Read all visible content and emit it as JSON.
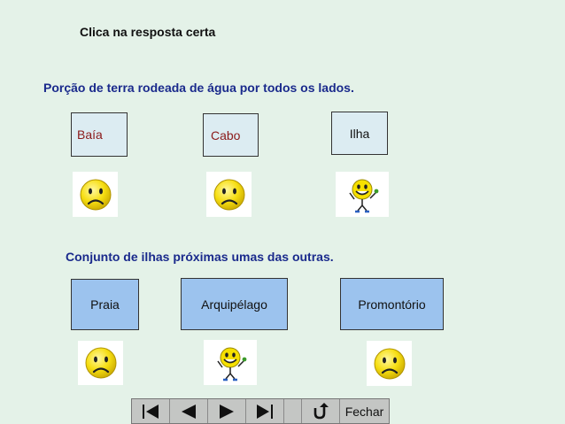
{
  "title": "Clica na resposta certa",
  "questions": [
    {
      "text": "Porção de terra rodeada de água por todos os lados.",
      "options": [
        {
          "label": "Baía",
          "text_color": "#8b1a1a",
          "feedback_icon": "sad-face-icon"
        },
        {
          "label": "Cabo",
          "text_color": "#8b1a1a",
          "feedback_icon": "sad-face-icon"
        },
        {
          "label": "Ilha",
          "text_color": "#111111",
          "feedback_icon": "happy-face-icon"
        }
      ]
    },
    {
      "text": "Conjunto de ilhas próximas umas das outras.",
      "options": [
        {
          "label": "Praia",
          "feedback_icon": "sad-face-icon"
        },
        {
          "label": "Arquipélago",
          "feedback_icon": "happy-face-icon"
        },
        {
          "label": "Promontório",
          "feedback_icon": "sad-face-icon"
        }
      ]
    }
  ],
  "nav": {
    "buttons": [
      "first-slide-icon",
      "previous-slide-icon",
      "next-slide-icon",
      "last-slide-icon",
      "return-icon"
    ],
    "close_label": "Fechar"
  },
  "colors": {
    "background": "#e4f2e8",
    "question_text": "#1a2a8c",
    "option_plain": "#dcecf2",
    "option_blue": "#9cc3ee",
    "navbar": "#c4c6c4",
    "smiley": "#f6de12"
  }
}
